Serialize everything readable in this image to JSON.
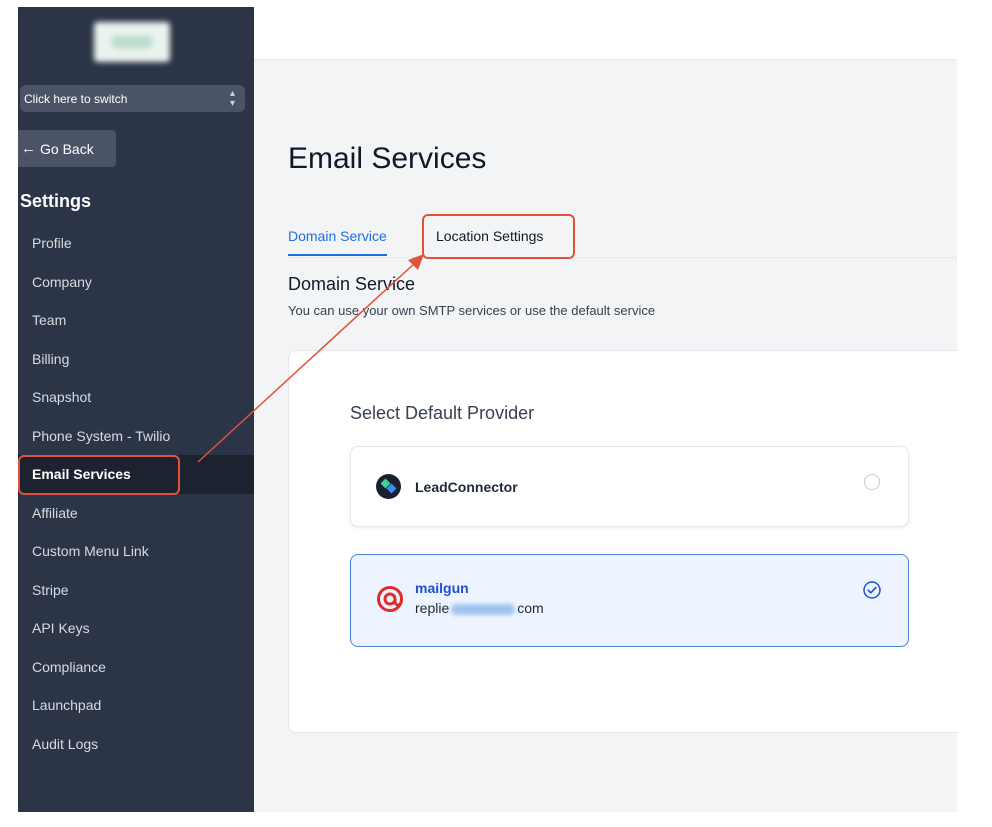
{
  "sidebar": {
    "switcher_label": "Click here to switch",
    "go_back_label": "Go Back",
    "settings_title": "Settings",
    "items": [
      {
        "label": "Profile"
      },
      {
        "label": "Company"
      },
      {
        "label": "Team"
      },
      {
        "label": "Billing"
      },
      {
        "label": "Snapshot"
      },
      {
        "label": "Phone System - Twilio"
      },
      {
        "label": "Email Services",
        "active": true
      },
      {
        "label": "Affiliate"
      },
      {
        "label": "Custom Menu Link"
      },
      {
        "label": "Stripe"
      },
      {
        "label": "API Keys"
      },
      {
        "label": "Compliance"
      },
      {
        "label": "Launchpad"
      },
      {
        "label": "Audit Logs"
      }
    ]
  },
  "main": {
    "title": "Email Services",
    "tabs": [
      {
        "label": "Domain Service",
        "active": true
      },
      {
        "label": "Location Settings",
        "active": false
      }
    ],
    "section_title": "Domain Service",
    "section_desc": "You can use your own SMTP services or use the default service",
    "card": {
      "title": "Select Default Provider",
      "providers": [
        {
          "name": "LeadConnector",
          "selected": false
        },
        {
          "name": "mailgun",
          "email_prefix": "replie",
          "email_suffix": "com",
          "selected": true
        }
      ]
    }
  },
  "icons": {
    "switcher": "chevron-up-down-icon",
    "go_back": "arrow-left-icon",
    "leadconnector": "leadconnector-logo-icon",
    "mailgun": "mailgun-logo-icon",
    "selected": "check-circle-icon",
    "unselected": "radio-empty-icon"
  },
  "colors": {
    "sidebar_bg": "#2c3547",
    "accent": "#1d6fe0",
    "annotation": "#e0523a",
    "selected_bg": "#edf4ff"
  }
}
